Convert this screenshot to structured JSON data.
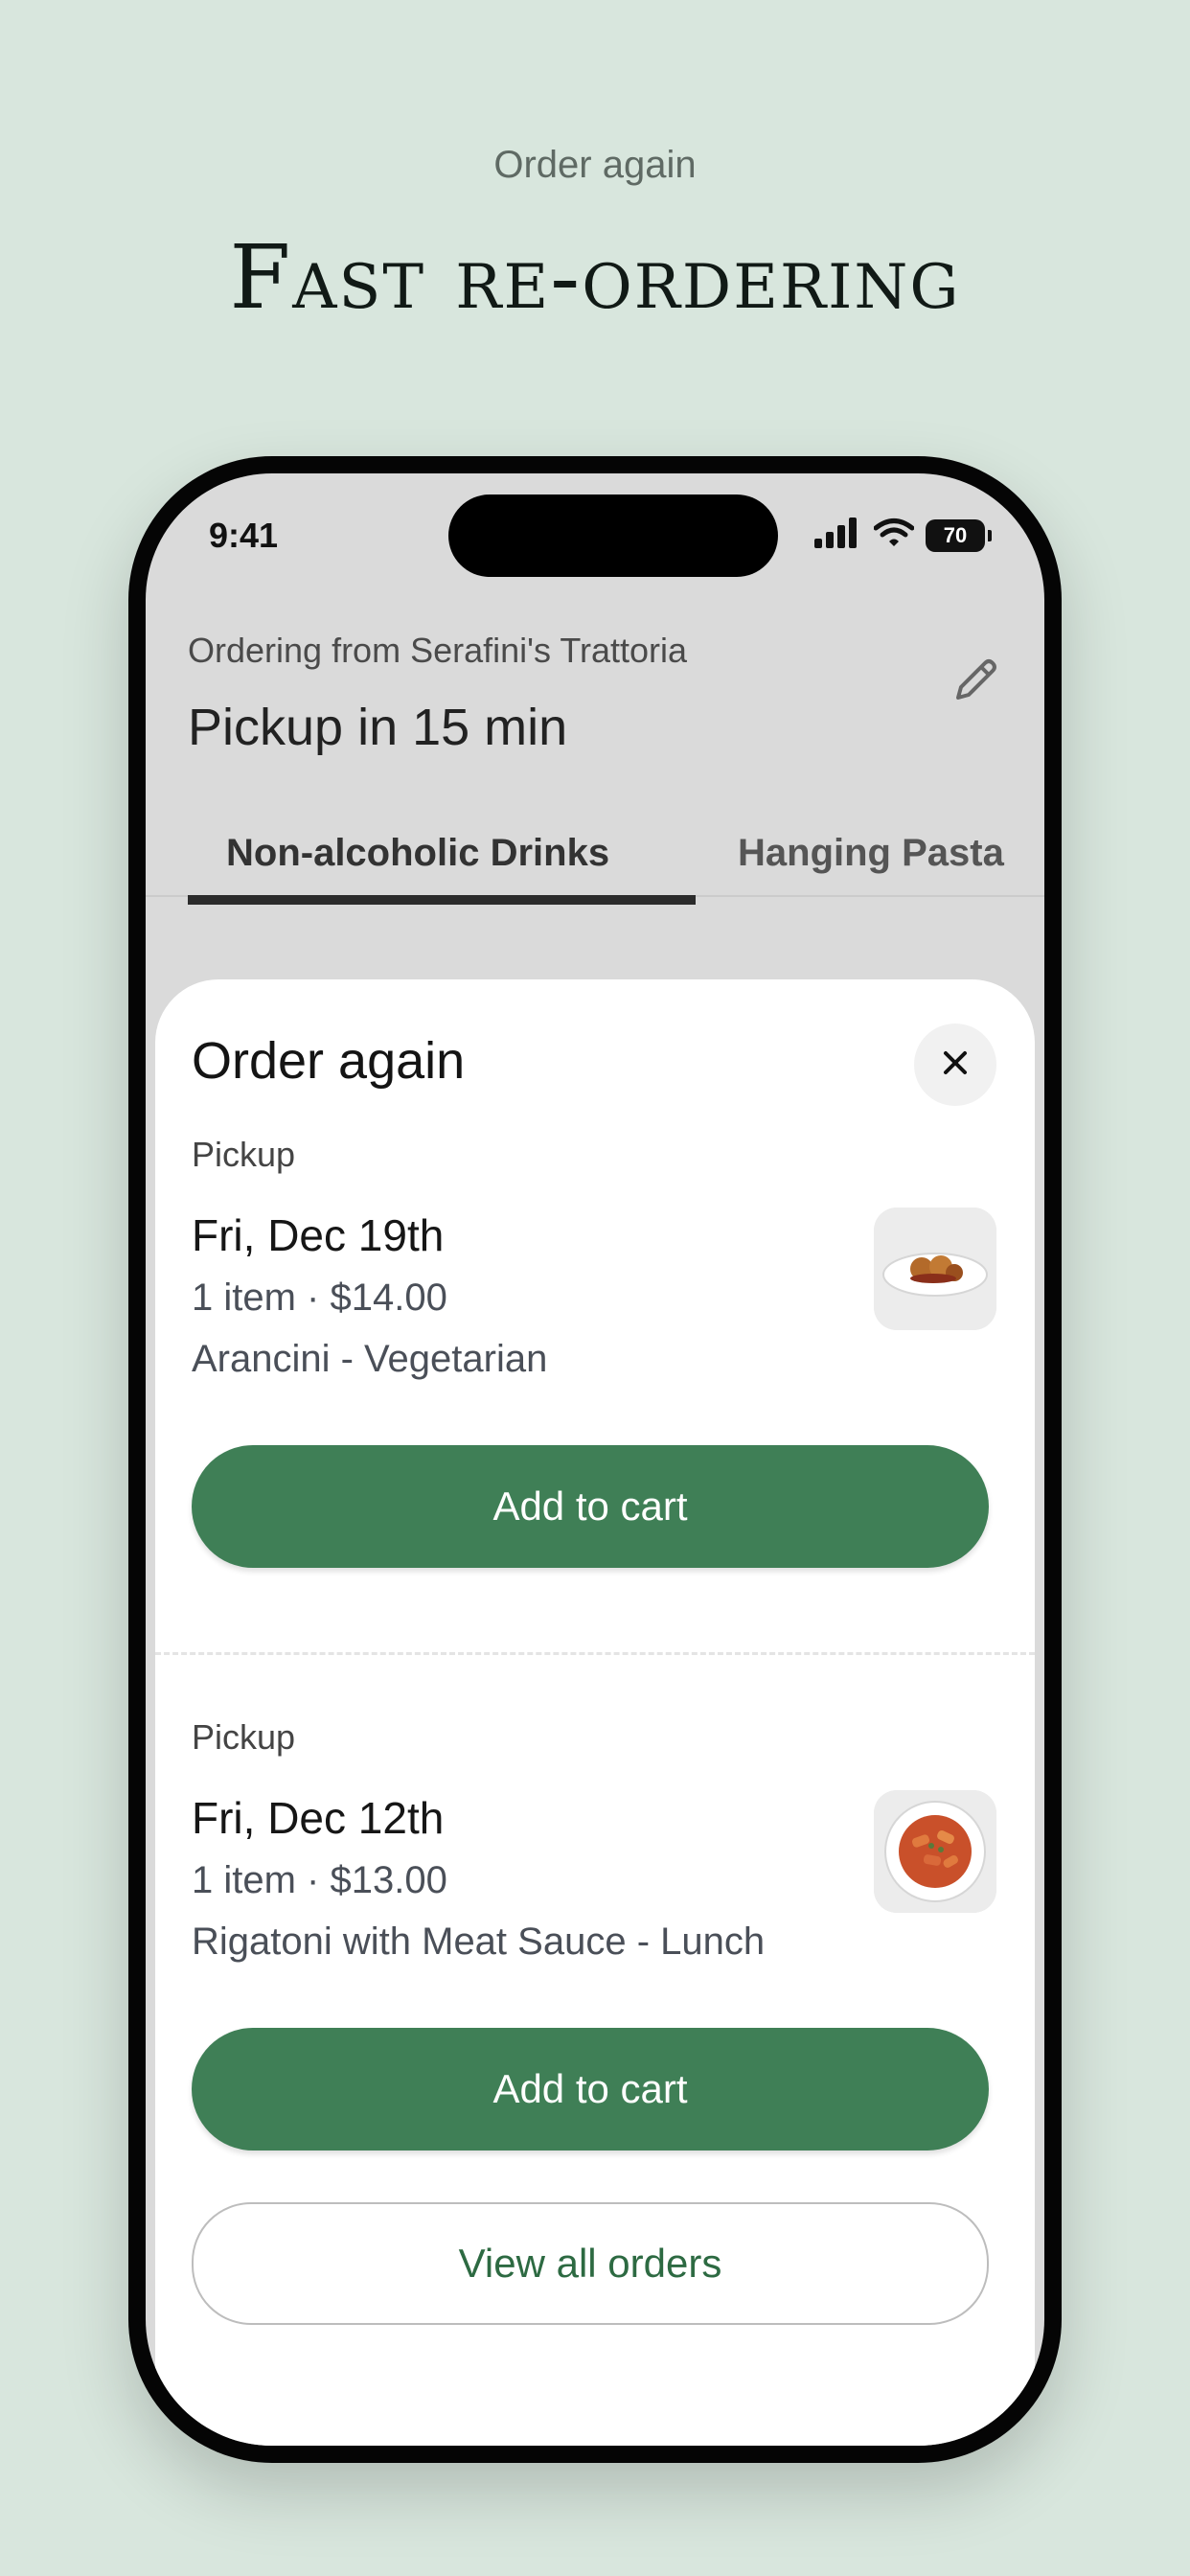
{
  "promo": {
    "eyebrow": "Order again",
    "headline": "Fast re-ordering"
  },
  "status_bar": {
    "time": "9:41",
    "battery": "70",
    "icons": [
      "signal-icon",
      "wifi-icon",
      "battery-icon"
    ]
  },
  "header": {
    "ordering_from": "Ordering from Serafini's Trattoria",
    "pickup_time": "Pickup in 15 min",
    "edit_icon": "pencil-icon"
  },
  "tabs": [
    {
      "label": "Non-alcoholic Drinks",
      "active": true
    },
    {
      "label": "Hanging Pasta",
      "active": false
    }
  ],
  "sheet": {
    "title": "Order again",
    "close_icon": "close-icon",
    "orders": [
      {
        "mode": "Pickup",
        "date": "Fri, Dec 19th",
        "count_price": "1 item · $14.00",
        "item_name": "Arancini - Vegetarian",
        "add_label": "Add to cart"
      },
      {
        "mode": "Pickup",
        "date": "Fri, Dec 12th",
        "count_price": "1 item · $13.00",
        "item_name": "Rigatoni with Meat Sauce - Lunch",
        "add_label": "Add to cart"
      }
    ],
    "view_all_label": "View all orders"
  },
  "colors": {
    "background": "#d8e6dd",
    "accent_green": "#3f7f56",
    "link_green": "#2d6a42"
  }
}
